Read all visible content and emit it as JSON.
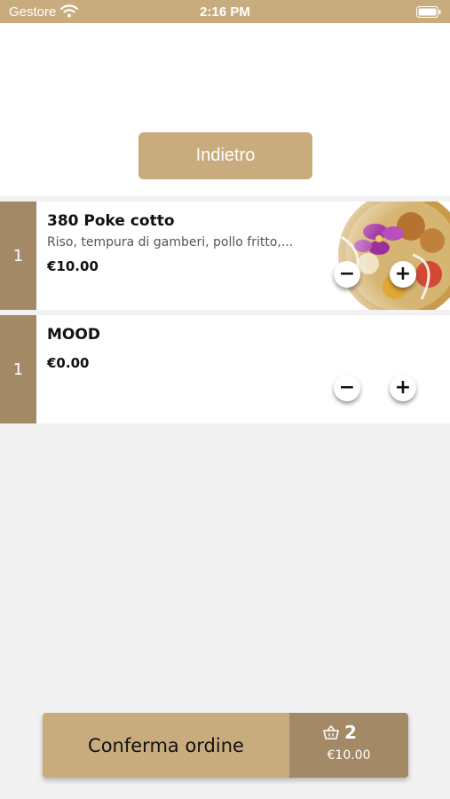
{
  "status_bar": {
    "carrier": "Gestore",
    "time": "2:16 PM"
  },
  "header": {
    "back_label": "Indietro"
  },
  "cart_items": [
    {
      "quantity": "1",
      "name": "380 Poke cotto",
      "description": "Riso, tempura di gamberi, pollo fritto,...",
      "price": "€10.00",
      "has_image": true
    },
    {
      "quantity": "1",
      "name": "MOOD",
      "description": "",
      "price": "€0.00",
      "has_image": false
    }
  ],
  "buttons": {
    "minus": "−",
    "plus": "+"
  },
  "footer": {
    "confirm_label": "Conferma ordine",
    "cart_count": "2",
    "cart_total": "€10.00"
  },
  "colors": {
    "accent": "#c9ac7d",
    "accent_dark": "#a38965",
    "background": "#f1f1f1"
  }
}
